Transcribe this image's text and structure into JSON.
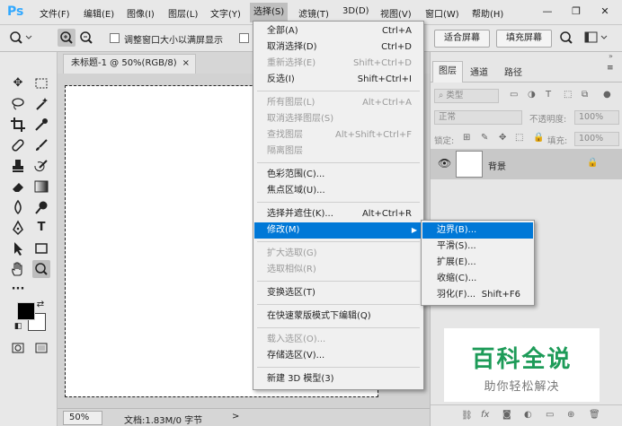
{
  "app": {
    "logo": "Ps"
  },
  "menubar": {
    "items": [
      "文件(F)",
      "编辑(E)",
      "图像(I)",
      "图层(L)",
      "文字(Y)",
      "选择(S)",
      "滤镜(T)",
      "3D(D)",
      "视图(V)",
      "窗口(W)",
      "帮助(H)"
    ],
    "window_buttons": {
      "minimize": "—",
      "restore": "❐",
      "close": "✕"
    }
  },
  "options_bar": {
    "resize_windows_label": "调整窗口大小以满屏显示",
    "fit_screen_label": "适合屏幕",
    "fill_screen_label": "填充屏幕"
  },
  "document": {
    "tab_title": "未标题-1 @ 50%(RGB/8)",
    "tab_close": "×",
    "zoom": "50%",
    "info": "文档:1.83M/0 字节",
    "status_arrow": ">"
  },
  "layers_panel": {
    "tabs": [
      "图层",
      "通道",
      "路径"
    ],
    "filter_kind": "类型",
    "blend_mode": "正常",
    "opacity_label": "不透明度:",
    "opacity_value": "100%",
    "lock_label": "锁定:",
    "fill_label": "填充:",
    "fill_value": "100%",
    "layer_name": "背景",
    "footer_icons": [
      "link-icon",
      "fx-icon",
      "mask-icon",
      "adjustment-icon",
      "group-icon",
      "new-layer-icon",
      "trash-icon"
    ]
  },
  "watermark": {
    "title": "百科全说",
    "subtitle": "助你轻松解决"
  },
  "select_menu": {
    "items": [
      {
        "label": "全部(A)",
        "shortcut": "Ctrl+A",
        "disabled": false
      },
      {
        "label": "取消选择(D)",
        "shortcut": "Ctrl+D",
        "disabled": false
      },
      {
        "label": "重新选择(E)",
        "shortcut": "Shift+Ctrl+D",
        "disabled": true
      },
      {
        "label": "反选(I)",
        "shortcut": "Shift+Ctrl+I",
        "disabled": false
      },
      {
        "label": "所有图层(L)",
        "shortcut": "Alt+Ctrl+A",
        "disabled": true
      },
      {
        "label": "取消选择图层(S)",
        "shortcut": "",
        "disabled": true
      },
      {
        "label": "查找图层",
        "shortcut": "Alt+Shift+Ctrl+F",
        "disabled": true
      },
      {
        "label": "隔离图层",
        "shortcut": "",
        "disabled": true
      },
      {
        "label": "色彩范围(C)...",
        "shortcut": "",
        "disabled": false
      },
      {
        "label": "焦点区域(U)...",
        "shortcut": "",
        "disabled": false
      },
      {
        "label": "选择并遮住(K)...",
        "shortcut": "Alt+Ctrl+R",
        "disabled": false
      },
      {
        "label": "修改(M)",
        "shortcut": "",
        "disabled": false
      },
      {
        "label": "扩大选取(G)",
        "shortcut": "",
        "disabled": true
      },
      {
        "label": "选取相似(R)",
        "shortcut": "",
        "disabled": true
      },
      {
        "label": "变换选区(T)",
        "shortcut": "",
        "disabled": false
      },
      {
        "label": "在快速蒙版模式下编辑(Q)",
        "shortcut": "",
        "disabled": false
      },
      {
        "label": "载入选区(O)...",
        "shortcut": "",
        "disabled": true
      },
      {
        "label": "存储选区(V)...",
        "shortcut": "",
        "disabled": false
      },
      {
        "label": "新建 3D 模型(3)",
        "shortcut": "",
        "disabled": false
      }
    ]
  },
  "modify_submenu": {
    "items": [
      {
        "label": "边界(B)...",
        "shortcut": ""
      },
      {
        "label": "平滑(S)...",
        "shortcut": ""
      },
      {
        "label": "扩展(E)...",
        "shortcut": ""
      },
      {
        "label": "收缩(C)...",
        "shortcut": ""
      },
      {
        "label": "羽化(F)...",
        "shortcut": "Shift+F6"
      }
    ]
  }
}
